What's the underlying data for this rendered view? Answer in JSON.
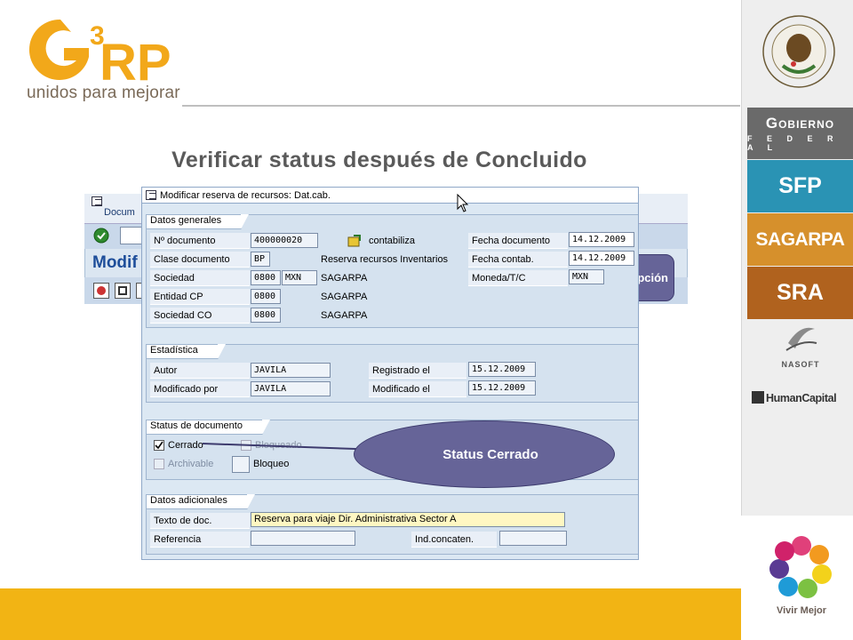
{
  "header": {
    "logo_mark": "G3RP",
    "logo_tagline": "unidos para mejorar"
  },
  "title": "Verificar status después de Concluido",
  "sidebar": {
    "gobierno": "Gobierno",
    "federal": "F E D E R A L",
    "sfp": "SFP",
    "sagarpa": "SAGARPA",
    "sra": "SRA",
    "nasoft": "NASOFT",
    "humancapital": "HumanCapital",
    "vivir_mejor": "Vivir Mejor"
  },
  "background_window": {
    "menu_label": "Docum",
    "heading": "Modif"
  },
  "sap": {
    "window_title": "Modificar reserva de recursos: Dat.cab.",
    "datos_generales": {
      "header": "Datos generales",
      "rows": [
        {
          "label": "Nº documento",
          "value": "400000020",
          "extra": "contabiliza",
          "rlabel": "Fecha documento",
          "rvalue": "14.12.2009"
        },
        {
          "label": "Clase documento",
          "value": "BP",
          "extra": "Reserva recursos Inventarios",
          "rlabel": "Fecha contab.",
          "rvalue": "14.12.2009"
        },
        {
          "label": "Sociedad",
          "value": "0800",
          "value2": "MXN",
          "extra": "SAGARPA",
          "rlabel": "Moneda/T/C",
          "rvalue": "MXN"
        },
        {
          "label": "Entidad CP",
          "value": "0800",
          "extra": "SAGARPA"
        },
        {
          "label": "Sociedad CO",
          "value": "0800",
          "extra": "SAGARPA"
        }
      ]
    },
    "estadistica": {
      "header": "Estadística",
      "autor_label": "Autor",
      "autor_value": "JAVILA",
      "modificado_label": "Modificado por",
      "modificado_value": "JAVILA",
      "registrado_label": "Registrado el",
      "registrado_value": "15.12.2009",
      "modificado_el_label": "Modificado el",
      "modificado_el_value": "15.12.2009"
    },
    "status": {
      "header": "Status de documento",
      "cerrado": "Cerrado",
      "bloqueado": "Bloqueado",
      "archivable": "Archivable",
      "bloqueo": "Bloqueo"
    },
    "adicionales": {
      "header": "Datos adicionales",
      "texto_label": "Texto de doc.",
      "texto_value": "Reserva para viaje Dir. Administrativa Sector A",
      "referencia_label": "Referencia",
      "indconcaten_label": "Ind.concaten."
    }
  },
  "callouts": {
    "status": "Status Cerrado",
    "opcion": "opción"
  },
  "colors": {
    "accent_yellow": "#f2b414",
    "callout": "#666498",
    "sap_bg": "#dce8f3"
  }
}
